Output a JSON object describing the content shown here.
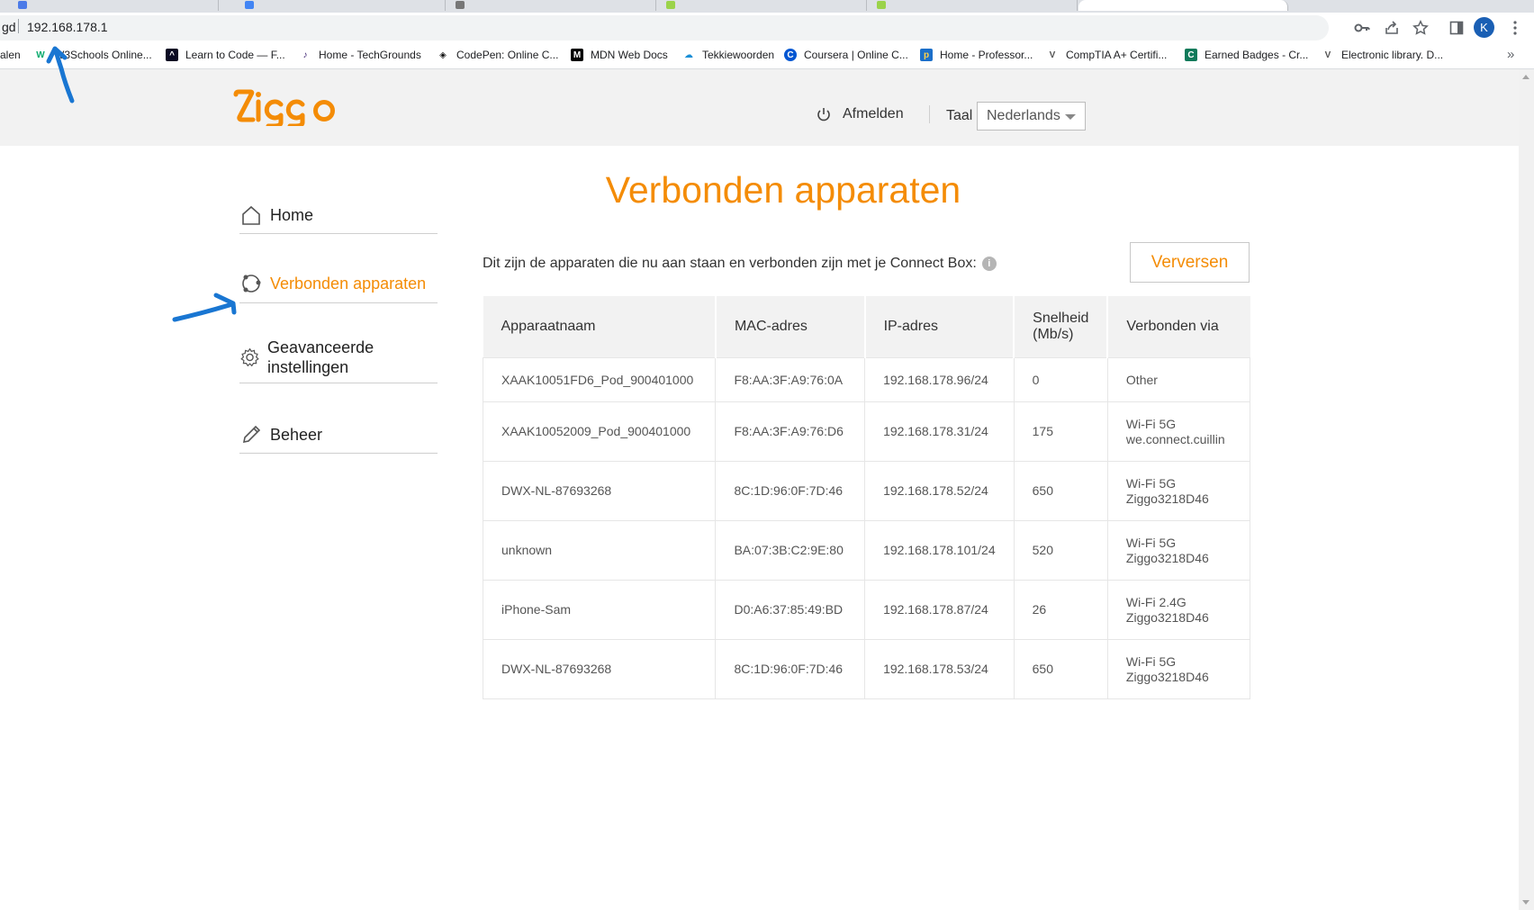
{
  "browser": {
    "address_cut": "gd",
    "url": "192.168.178.1",
    "profile_initial": "K",
    "bookmarks": [
      {
        "label": "alen",
        "icon": ""
      },
      {
        "label": "W3Schools Online...",
        "icon": "w3schools-icon"
      },
      {
        "label": "Learn to Code — F...",
        "icon": "freecodecamp-icon"
      },
      {
        "label": "Home - TechGrounds",
        "icon": "techgrounds-icon"
      },
      {
        "label": "CodePen: Online C...",
        "icon": "codepen-icon"
      },
      {
        "label": "MDN Web Docs",
        "icon": "mdn-icon"
      },
      {
        "label": "Tekkiewoorden",
        "icon": "tekkiewoorden-icon"
      },
      {
        "label": "Coursera | Online C...",
        "icon": "coursera-icon"
      },
      {
        "label": "Home - Professor...",
        "icon": "professor-icon"
      },
      {
        "label": "CompTIA A+ Certifi...",
        "icon": "comptia-icon"
      },
      {
        "label": "Earned Badges - Cr...",
        "icon": "credly-icon"
      },
      {
        "label": "Electronic library. D...",
        "icon": "library-icon"
      }
    ],
    "bookmarks_more": "»"
  },
  "header": {
    "logo": "ziggo",
    "signout_label": "Afmelden",
    "language_label": "Taal",
    "language_value": "Nederlands"
  },
  "sidebar": {
    "items": [
      {
        "label": "Home",
        "icon": "home-icon"
      },
      {
        "label": "Verbonden apparaten",
        "icon": "devices-icon",
        "active": true
      },
      {
        "label": "Geavanceerde instellingen",
        "icon": "gear-icon"
      },
      {
        "label": "Beheer",
        "icon": "pencil-icon"
      }
    ]
  },
  "main": {
    "title": "Verbonden apparaten",
    "intro": "Dit zijn de apparaten die nu aan staan en verbonden zijn met je Connect Box:",
    "info_glyph": "i",
    "refresh_label": "Verversen",
    "table": {
      "headers": [
        "Apparaatnaam",
        "MAC-adres",
        "IP-adres",
        "Snelheid (Mb/s)",
        "Verbonden via"
      ],
      "rows": [
        {
          "name": "XAAK10051FD6_Pod_900401000",
          "mac": "F8:AA:3F:A9:76:0A",
          "ip": "192.168.178.96/24",
          "speed": "0",
          "via1": "Other",
          "via2": ""
        },
        {
          "name": "XAAK10052009_Pod_900401000",
          "mac": "F8:AA:3F:A9:76:D6",
          "ip": "192.168.178.31/24",
          "speed": "175",
          "via1": "Wi-Fi 5G",
          "via2": "we.connect.cuillin"
        },
        {
          "name": "DWX-NL-87693268",
          "mac": "8C:1D:96:0F:7D:46",
          "ip": "192.168.178.52/24",
          "speed": "650",
          "via1": "Wi-Fi 5G",
          "via2": "Ziggo3218D46"
        },
        {
          "name": "unknown",
          "mac": "BA:07:3B:C2:9E:80",
          "ip": "192.168.178.101/24",
          "speed": "520",
          "via1": "Wi-Fi 5G",
          "via2": "Ziggo3218D46"
        },
        {
          "name": "iPhone-Sam",
          "mac": "D0:A6:37:85:49:BD",
          "ip": "192.168.178.87/24",
          "speed": "26",
          "via1": "Wi-Fi 2.4G",
          "via2": "Ziggo3218D46"
        },
        {
          "name": "DWX-NL-87693268",
          "mac": "8C:1D:96:0F:7D:46",
          "ip": "192.168.178.53/24",
          "speed": "650",
          "via1": "Wi-Fi 5G",
          "via2": "Ziggo3218D46"
        }
      ]
    }
  },
  "colors": {
    "accent": "#f48c06",
    "annotation": "#1976d2"
  }
}
